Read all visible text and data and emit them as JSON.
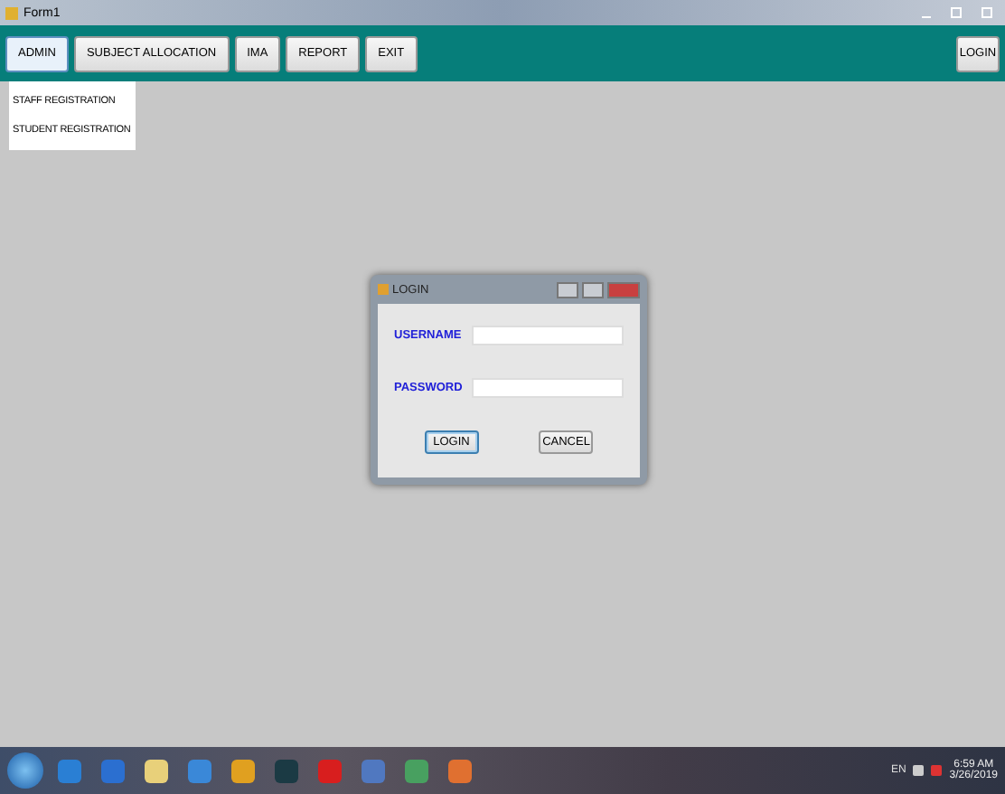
{
  "window": {
    "title": "Form1"
  },
  "menu_buttons": [
    {
      "label": "ADMIN",
      "expanded": true
    },
    {
      "label": "SUBJECT ALLOCATION",
      "expanded": false
    },
    {
      "label": "IMA",
      "expanded": false
    },
    {
      "label": "REPORT",
      "expanded": false
    },
    {
      "label": "EXIT",
      "expanded": false
    }
  ],
  "login_button": "LOGIN",
  "dropdown": {
    "items": [
      "STAFF REGISTRATION",
      "STUDENT REGISTRATION"
    ]
  },
  "dialog": {
    "title": "LOGIN",
    "fields": [
      {
        "label": "USERNAME"
      },
      {
        "label": "PASSWORD"
      }
    ],
    "buttons": [
      {
        "label": "LOGIN",
        "selected": true
      },
      {
        "label": "CANCEL",
        "selected": false
      }
    ]
  },
  "taskbar": {
    "language": "EN",
    "time": "6:59 AM",
    "date": "3/26/2019"
  }
}
